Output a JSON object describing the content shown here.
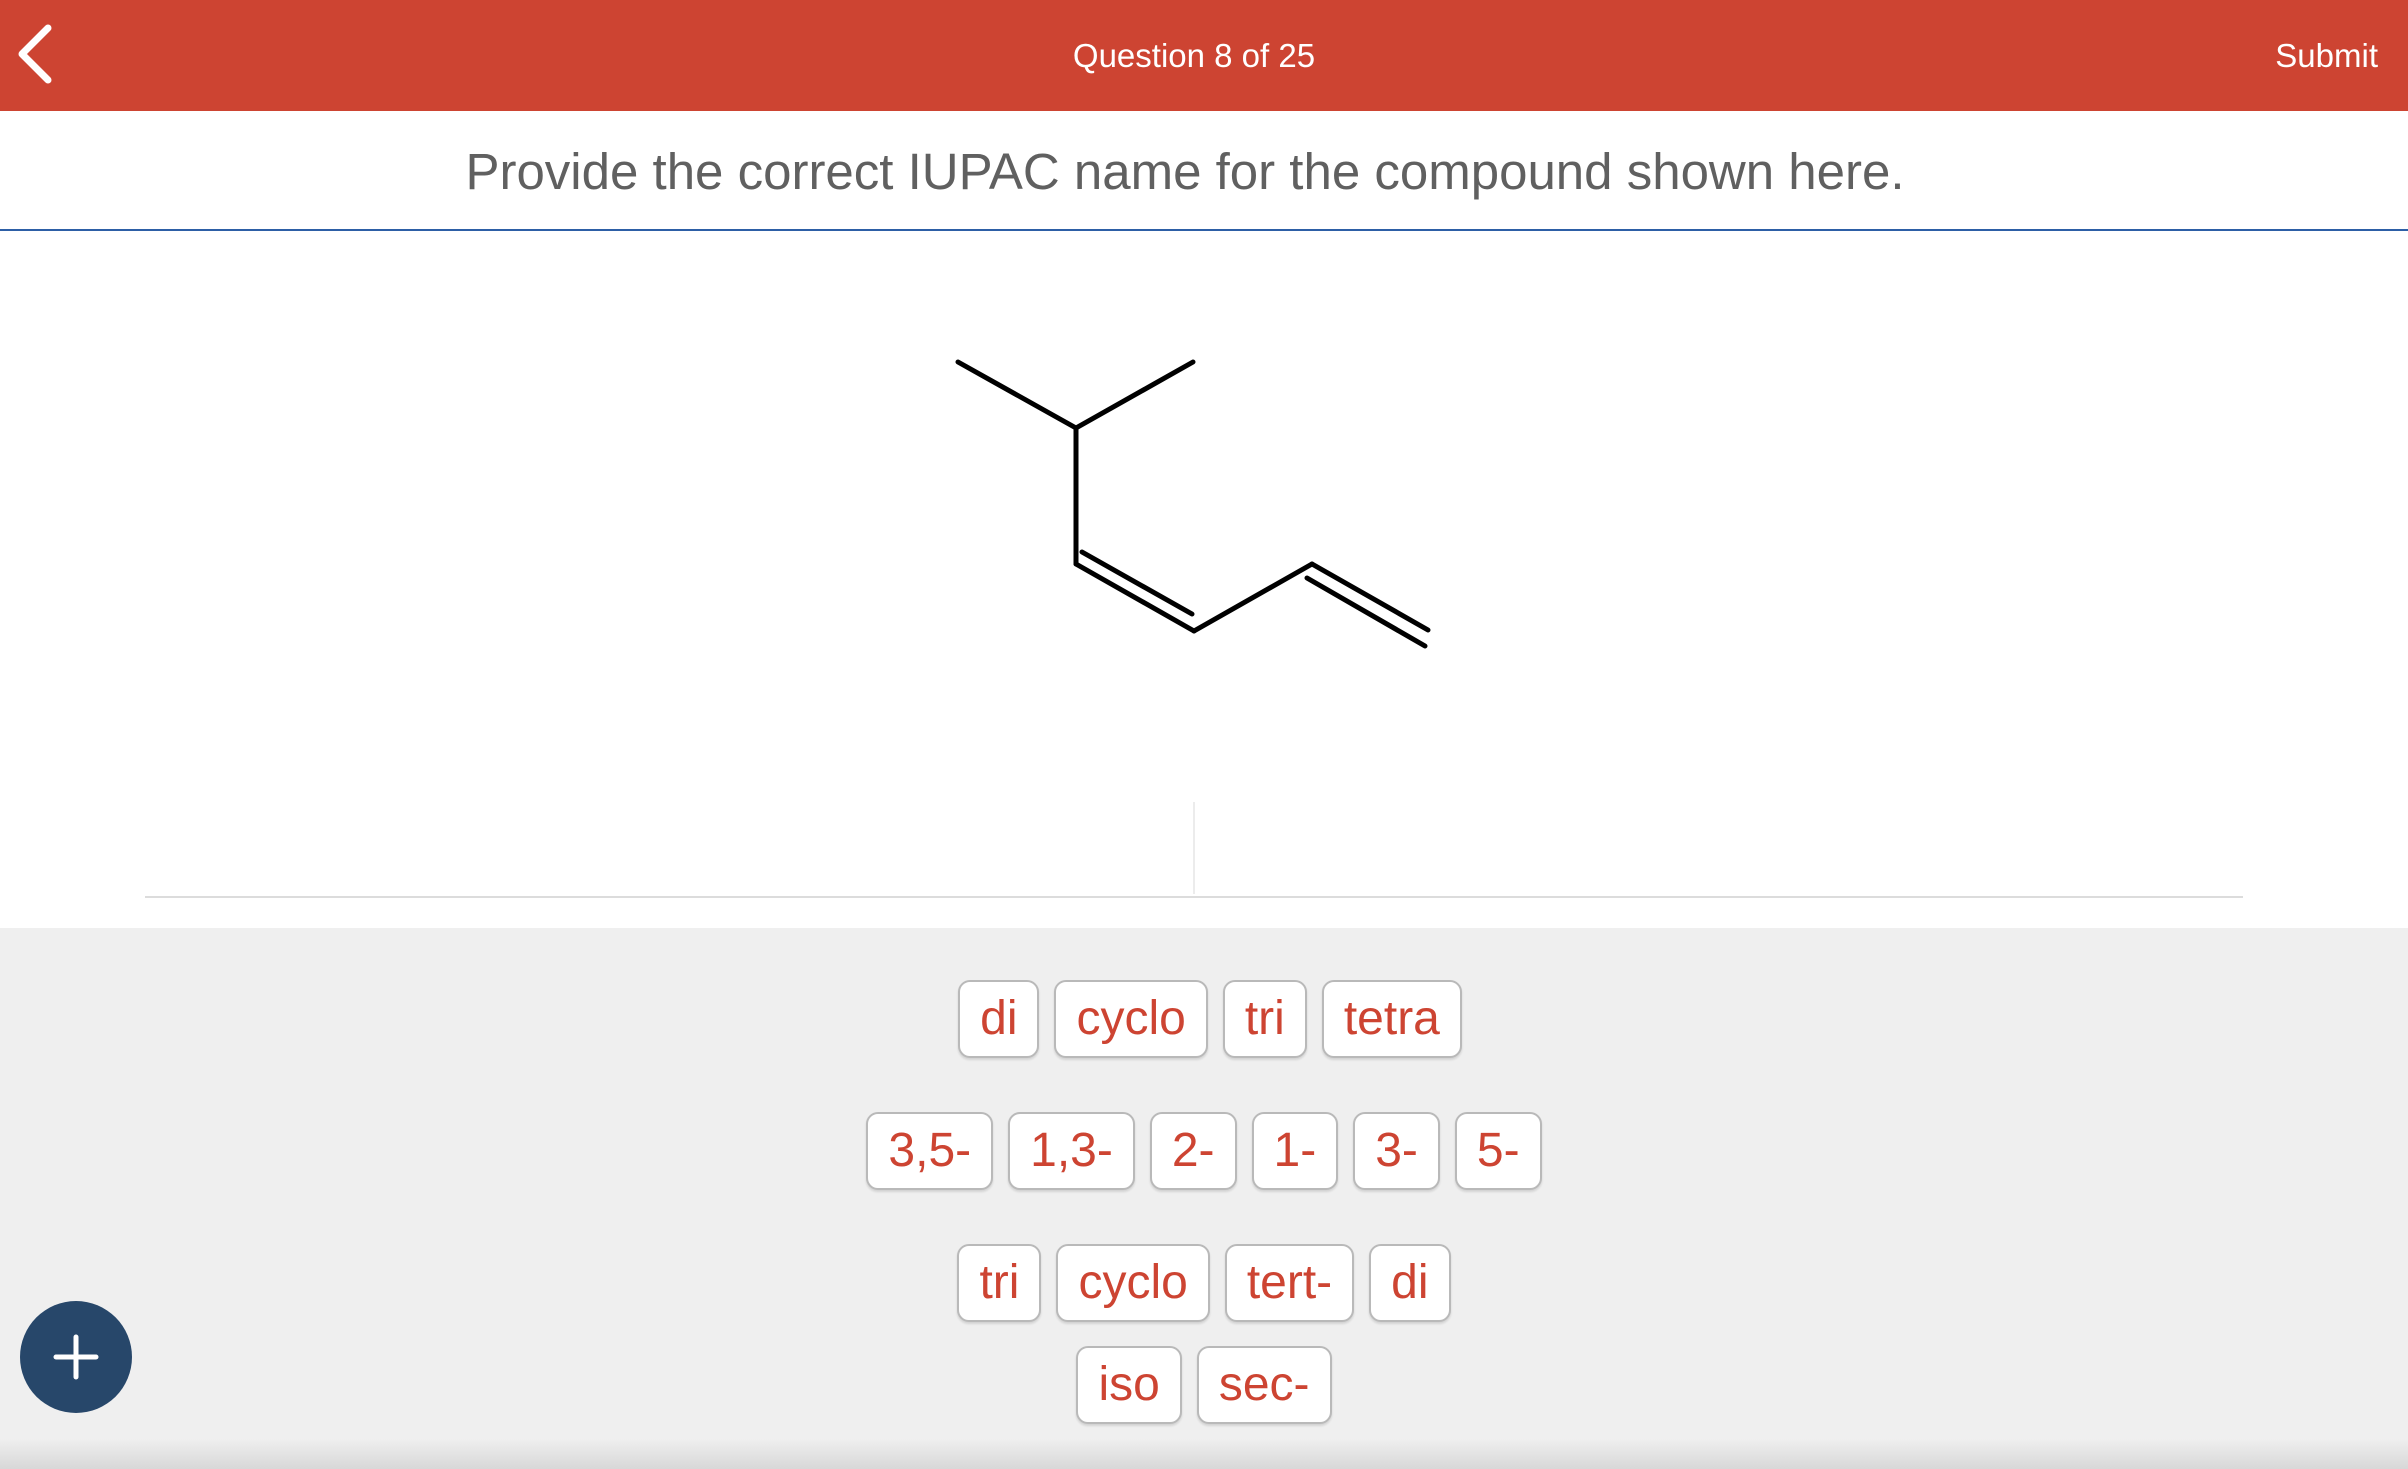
{
  "header": {
    "title": "Question 8 of 25",
    "submit_label": "Submit",
    "back_icon": "chevron-left-icon",
    "background_color": "#cd4432"
  },
  "question": {
    "text": "Provide the correct IUPAC name for the compound shown here."
  },
  "tiles": {
    "row1": [
      "di",
      "cyclo",
      "tri",
      "tetra"
    ],
    "row2": [
      "3,5-",
      "1,3-",
      "2-",
      "1-",
      "3-",
      "5-"
    ],
    "row3": [
      "tri",
      "cyclo",
      "tert-",
      "di"
    ],
    "row4": [
      "iso",
      "sec-"
    ],
    "text_color": "#cd4432"
  },
  "add_button": {
    "icon": "plus-icon",
    "color": "#27476a"
  }
}
